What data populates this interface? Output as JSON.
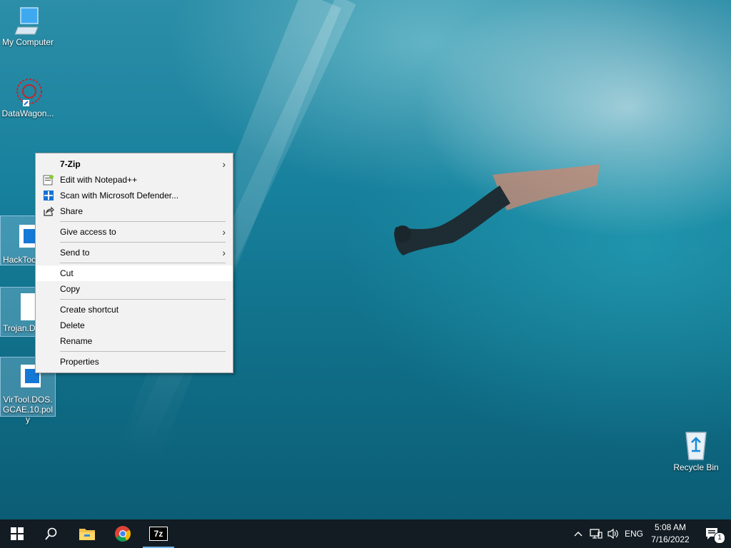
{
  "desktop": {
    "icons": {
      "my_computer": "My Computer",
      "datawagon": "DataWagon...",
      "hacktool": "HackToo",
      "trojan": "Trojan.DO",
      "virtool": "VirTool.DOS.GCAE.10.poly",
      "recycle_bin": "Recycle Bin"
    }
  },
  "context_menu": {
    "items": [
      {
        "label": "7-Zip",
        "has_submenu": true
      },
      {
        "label": "Edit with Notepad++"
      },
      {
        "label": "Scan with Microsoft Defender..."
      },
      {
        "label": "Share"
      },
      {
        "label": "Give access to",
        "has_submenu": true
      },
      {
        "label": "Send to",
        "has_submenu": true
      },
      {
        "label": "Cut",
        "highlighted": true
      },
      {
        "label": "Copy"
      },
      {
        "label": "Create shortcut"
      },
      {
        "label": "Delete"
      },
      {
        "label": "Rename"
      },
      {
        "label": "Properties"
      }
    ],
    "submenu_arrow": "›"
  },
  "taskbar": {
    "apps": [
      "start-icon",
      "search-icon",
      "file-explorer-icon",
      "chrome-icon",
      "7zip-icon"
    ],
    "sevenzip_label": "7z",
    "tray": {
      "chevron": "^",
      "language": "ENG",
      "notification_count": "1"
    },
    "clock": {
      "time": "5:08 AM",
      "date": "7/16/2022"
    }
  },
  "colors": {
    "menu_bg": "#f2f2f2",
    "menu_hot": "#ffffff",
    "taskbar_bg": "#121c22",
    "accent": "#6fb3e6"
  }
}
